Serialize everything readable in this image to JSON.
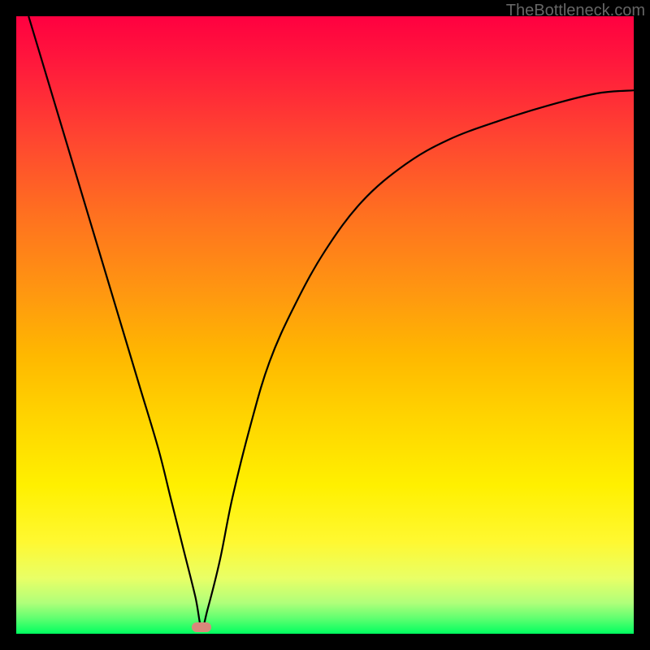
{
  "watermark": "TheBottleneck.com",
  "chart_data": {
    "type": "line",
    "title": "",
    "xlabel": "",
    "ylabel": "",
    "xlim": [
      0,
      100
    ],
    "ylim": [
      0,
      100
    ],
    "x": [
      2,
      5,
      8,
      11,
      14,
      17,
      20,
      23,
      25,
      27,
      29,
      30,
      31,
      33,
      35,
      38,
      41,
      45,
      50,
      56,
      63,
      70,
      78,
      86,
      94,
      100
    ],
    "values": [
      100,
      90,
      80,
      70,
      60,
      50,
      40,
      30,
      22,
      14,
      6,
      1,
      4,
      12,
      22,
      34,
      44,
      53,
      62,
      70,
      76,
      80,
      83,
      85.5,
      87.5,
      88
    ],
    "marker": {
      "x": 30,
      "y": 1
    },
    "grid": false,
    "background": "vertical-gradient-red-yellow-green"
  },
  "colors": {
    "curve": "#000000",
    "marker_fill": "#d8887a",
    "frame": "#000000"
  }
}
